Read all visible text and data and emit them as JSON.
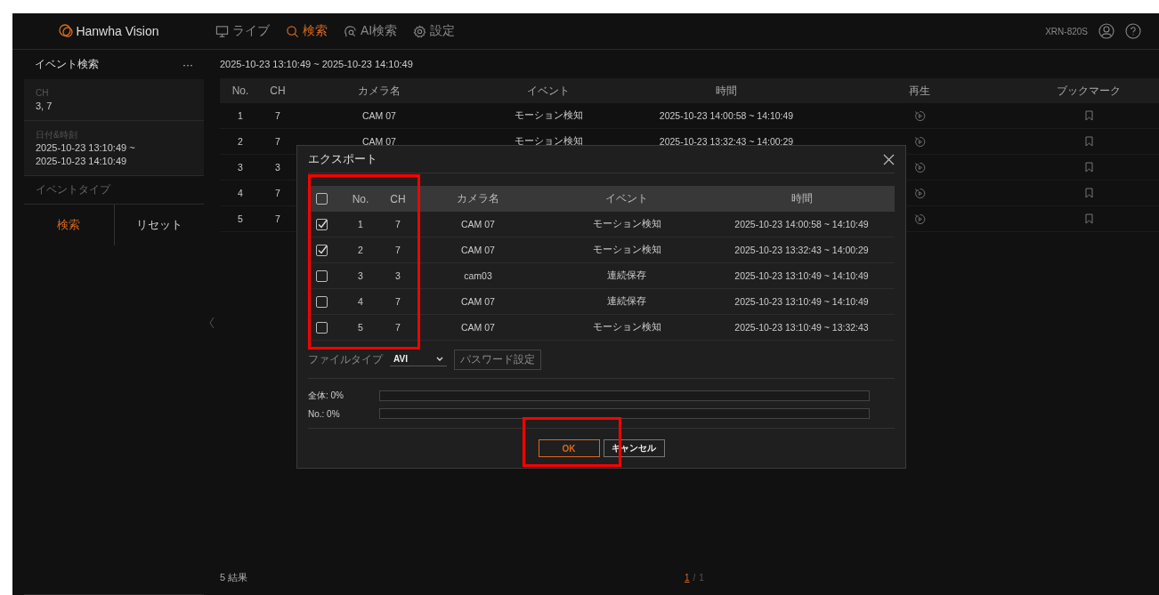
{
  "header": {
    "logo": "Hanwha Vision",
    "nav": [
      {
        "label": "ライブ",
        "kind": "monitor",
        "selected": false
      },
      {
        "label": "検索",
        "kind": "search",
        "selected": true
      },
      {
        "label": "AI検索",
        "kind": "ai",
        "selected": false
      },
      {
        "label": "設定",
        "kind": "gear",
        "selected": false
      }
    ],
    "device": "XRN-820S"
  },
  "sidebar": {
    "title": "イベント検索",
    "more": "···",
    "fields": [
      {
        "label": "CH",
        "lines": [
          "3, 7"
        ]
      },
      {
        "label": "日付&時刻",
        "lines": [
          "2025-10-23 13:10:49 ~",
          "2025-10-23 14:10:49"
        ]
      }
    ],
    "event_type": "イベントタイプ",
    "search_button": "検索",
    "reset_button": "リセット"
  },
  "main": {
    "range": "2025-10-23 13:10:49 ~ 2025-10-23 14:10:49",
    "columns": [
      "No.",
      "CH",
      "カメラ名",
      "イベント",
      "時間",
      "再生",
      "ブックマーク"
    ],
    "rows": [
      {
        "no": "1",
        "ch": "7",
        "camera": "CAM 07",
        "event": "モーション検知",
        "time": "2025-10-23 14:00:58 ~ 14:10:49"
      },
      {
        "no": "2",
        "ch": "7",
        "camera": "CAM 07",
        "event": "モーション検知",
        "time": "2025-10-23 13:32:43 ~ 14:00:29"
      },
      {
        "no": "3",
        "ch": "3"
      },
      {
        "no": "4",
        "ch": "7"
      },
      {
        "no": "5",
        "ch": "7"
      }
    ],
    "result_count": "5 結果",
    "pagination": {
      "current": "1",
      "separator": "/",
      "total": "1"
    }
  },
  "export_dialog": {
    "title": "エクスポート",
    "select_all_checked": false,
    "columns": [
      "No.",
      "CH",
      "カメラ名",
      "イベント",
      "時間"
    ],
    "rows": [
      {
        "checked": true,
        "no": "1",
        "ch": "7",
        "camera": "CAM 07",
        "event": "モーション検知",
        "time": "2025-10-23 14:00:58 ~ 14:10:49"
      },
      {
        "checked": true,
        "no": "2",
        "ch": "7",
        "camera": "CAM 07",
        "event": "モーション検知",
        "time": "2025-10-23 13:32:43 ~ 14:00:29"
      },
      {
        "checked": false,
        "no": "3",
        "ch": "3",
        "camera": "cam03",
        "event": "連続保存",
        "time": "2025-10-23 13:10:49 ~ 14:10:49"
      },
      {
        "checked": false,
        "no": "4",
        "ch": "7",
        "camera": "CAM 07",
        "event": "連続保存",
        "time": "2025-10-23 13:10:49 ~ 14:10:49"
      },
      {
        "checked": false,
        "no": "5",
        "ch": "7",
        "camera": "CAM 07",
        "event": "モーション検知",
        "time": "2025-10-23 13:10:49 ~ 13:32:43"
      }
    ],
    "file_type_label": "ファイルタイプ",
    "file_type": "AVI",
    "password_button": {
      "label": "パスワード設定",
      "disabled": true
    },
    "progress": [
      {
        "label": "全体: 0%",
        "level": 0
      },
      {
        "label": "No.: 0%",
        "level": 0
      }
    ],
    "ok_button": "OK",
    "cancel_button": "キャンセル"
  }
}
